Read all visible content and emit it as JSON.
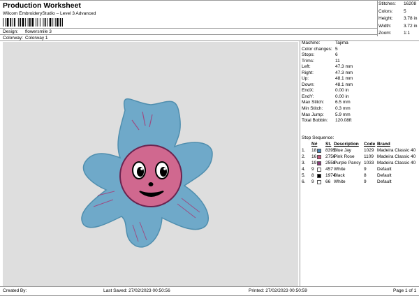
{
  "header": {
    "title": "Production Worksheet",
    "subtitle": "Wilcom EmbroideryStudio – Level 3 Advanced"
  },
  "meta": {
    "design_label": "Design:",
    "design_value": "flowersmile 3",
    "colorway_label": "Colorway:",
    "colorway_value": "Colorway 1"
  },
  "stats": [
    {
      "label": "Stitches:",
      "value": "16208"
    },
    {
      "label": "Colors:",
      "value": "5"
    },
    {
      "label": "Height:",
      "value": "3.78 in"
    },
    {
      "label": "Width:",
      "value": "3.72 in"
    },
    {
      "label": "Zoom:",
      "value": "1:1"
    }
  ],
  "machine_info": [
    {
      "label": "Machine:",
      "value": "Tajima"
    },
    {
      "label": "Color changes:",
      "value": "5"
    },
    {
      "label": "Stops:",
      "value": "6"
    },
    {
      "label": "Trims:",
      "value": "11"
    },
    {
      "label": "Left:",
      "value": "47.3 mm"
    },
    {
      "label": "Right:",
      "value": "47.3 mm"
    },
    {
      "label": "Up:",
      "value": "48.1 mm"
    },
    {
      "label": "Down:",
      "value": "48.1 mm"
    },
    {
      "label": "EndX:",
      "value": "0.00 in"
    },
    {
      "label": "EndY:",
      "value": "0.00 in"
    },
    {
      "label": "Max Stitch:",
      "value": "6.5 mm"
    },
    {
      "label": "Min Stitch:",
      "value": "0.3 mm"
    },
    {
      "label": "Max Jump:",
      "value": "5.9 mm"
    },
    {
      "label": "Total Bobbin:",
      "value": "120.08ft"
    }
  ],
  "stop_sequence": {
    "title": "Stop Sequence:",
    "headers": {
      "num": "N#",
      "st": "St.",
      "desc": "Description",
      "code": "Code",
      "brand": "Brand"
    },
    "rows": [
      {
        "idx": "1.",
        "n": "18",
        "st": "8395",
        "desc": "Blue Jay",
        "code": "1029",
        "brand": "Madeira Classic 40",
        "color": "#4a86b8"
      },
      {
        "idx": "2.",
        "n": "16",
        "st": "2756",
        "desc": "Pink Rose",
        "code": "1109",
        "brand": "Madeira Classic 40",
        "color": "#c8557f"
      },
      {
        "idx": "3.",
        "n": "19",
        "st": "2558",
        "desc": "Purple Pansy",
        "code": "1033",
        "brand": "Madeira Classic 40",
        "color": "#8a3c7a"
      },
      {
        "idx": "4.",
        "n": "9",
        "st": "457",
        "desc": "White",
        "code": "9",
        "brand": "Default",
        "color": "#ffffff"
      },
      {
        "idx": "5.",
        "n": "8",
        "st": "1974",
        "desc": "Black",
        "code": "8",
        "brand": "Default",
        "color": "#000000"
      },
      {
        "idx": "6.",
        "n": "9",
        "st": "66",
        "desc": "White",
        "code": "9",
        "brand": "Default",
        "color": "#ffffff"
      }
    ]
  },
  "footer": {
    "created_by": "Created By:",
    "last_saved": "Last Saved: 27/02/2023 00:50:56",
    "printed": "Printed: 27/02/2023 00:50:59",
    "page": "Page 1 of 1"
  },
  "colors": {
    "canvas_bg": "#dedede",
    "petal": "#6fa9c9",
    "face": "#d0688f",
    "face_outline": "#6b2450"
  }
}
